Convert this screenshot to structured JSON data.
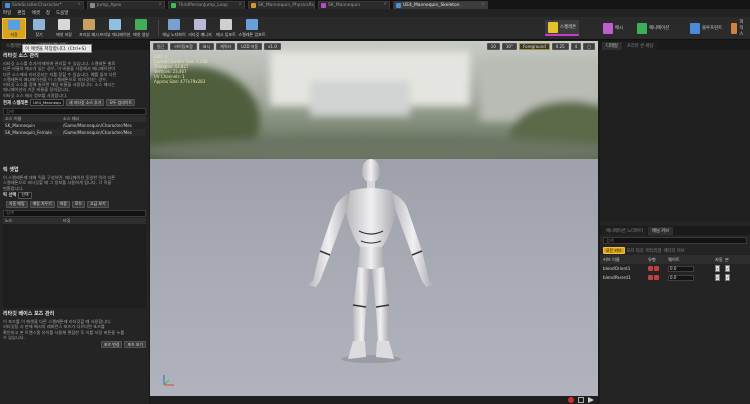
{
  "tabs": [
    {
      "label": "SideScrollerCharacter*",
      "icon_color": "#4a90d9",
      "active": false
    },
    {
      "label": "Jump_Apex",
      "icon_color": "#8a8a8a",
      "active": false
    },
    {
      "label": "ThirdPersonJump_Loop",
      "icon_color": "#3dbd5a",
      "active": false
    },
    {
      "label": "SK_Mannequin_PhysicsAsset",
      "icon_color": "#d29a2a",
      "active": false
    },
    {
      "label": "SK_Mannequin",
      "icon_color": "#b050c8",
      "active": false
    },
    {
      "label": "UE4_Mannequin_Skeleton",
      "icon_color": "#4a90d9",
      "active": true
    }
  ],
  "menu": [
    "파일",
    "편집",
    "애셋",
    "창",
    "도움말"
  ],
  "toolbar": {
    "buttons": [
      {
        "label": "저장",
        "icon_color": "#5aa0e0"
      },
      {
        "label": "찾기",
        "icon_color": "#8fb4d8"
      },
      {
        "label": "애셋 저장",
        "icon_color": "#d8d8d8"
      },
      {
        "label": "프리뷰 메시",
        "icon_color": "#c8a060"
      },
      {
        "label": "프리뷰 애니메이션",
        "icon_color": "#8fc0e0"
      },
      {
        "label": "애셋 생성",
        "icon_color": "#3fae56"
      }
    ],
    "right_buttons": [
      {
        "label": "애님 노티파이",
        "icon_color": "#7aa0d0"
      },
      {
        "label": "리타깃 매니저",
        "icon_color": "#b8b8d8"
      },
      {
        "label": "메시 임포트",
        "icon_color": "#d0d0d0"
      },
      {
        "label": "스켈레톤 임포트",
        "icon_color": "#6aa0d8"
      }
    ],
    "modes": [
      {
        "label": "스켈레톤",
        "icon_color": "#e6c229",
        "active": true
      },
      {
        "label": "메시",
        "icon_color": "#c060d0",
        "active": false
      },
      {
        "label": "애니메이션",
        "icon_color": "#3fae56",
        "active": false
      },
      {
        "label": "블루프린트",
        "icon_color": "#4a8ad8",
        "active": false
      },
      {
        "label": "피직스",
        "icon_color": "#d08040",
        "active": false
      }
    ]
  },
  "tooltip": "이 애셋을 저장합니다. (Ctrl+S)",
  "left_panel": {
    "tabs": [
      "스켈레톤 트리",
      "리타깃 매니저"
    ],
    "retarget_source": {
      "title": "리타깃 소스 관리",
      "desc": [
        "리타깃 소스를 추가/삭제하여 관리할 수 있습니다. 스켈레톤 별로",
        "다른 비율의 메시가 있는 경우, 이 비율을 사용해서 애니메이션이",
        "다른 소스에서 리타깃되는 지를 정할 수 있습니다. 예를 들어 다른",
        "스켈레톤의 애니메이션을 이 스켈레톤으로 리타깃하는 경우,",
        "리타깃 소스를 정해 놓으면 해당 비율을 사용합니다. 소스 메시는",
        "애니메이션의 기준 비율을 정의합니다.",
        "리타깃 소스 메시 정보를 사용합니다."
      ],
      "current_label": "현재 스켈레톤",
      "current_value": "UE4_Mannequ",
      "add_button": "새 리타깃 소스 추가",
      "update_button": "모두 업데이트",
      "search_placeholder": "검색",
      "columns": [
        "소스 이름",
        "소스 메시"
      ],
      "rows": [
        {
          "name": "SK_Mannequin",
          "mesh": "/Game/Mannequin/Character/Mes"
        },
        {
          "name": "SK_Mannequin_Female",
          "mesh": "/Game/Mannequin/Character/Mes"
        }
      ]
    },
    "rig_setup": {
      "title": "릭 셋업",
      "desc": [
        "이 스켈레톤에 대해 릭을 구성하면, 애니메이션 동일한 릭의 다른",
        "스켈레톤으로 리타깃할 때 그 정보를 사용하게 됩니다. 각 릭을",
        "변환합니다."
      ],
      "select_label": "릭 선택",
      "select_value": "선택",
      "buttons": [
        "자동 매핑",
        "매핑 지우기",
        "저장",
        "로드",
        "고급 보기"
      ],
      "search_placeholder": "검색",
      "columns": [
        "노드",
        "타깃"
      ]
    },
    "base_pose": {
      "title": "리타깃 베이스 포즈 관리",
      "desc": [
        "이 포즈를 이 애셋을 다른 스켈레톤에 리타깃할 때 사용합니다.",
        "리타깃팅 시 판에 메시의 레퍼런스 포즈가 다르다면 포즈를",
        "확인하고 본 트랜스폼 유치를 사용해 편집한 후 이를 저장 버튼을 누를",
        "수 있습니다."
      ],
      "buttons": [
        "포즈 변경",
        "포즈 보기"
      ]
    }
  },
  "viewport": {
    "buttons": [
      "원근",
      "라이팅포함",
      "표시",
      "캐릭터",
      "LOD 자동",
      "x1.0"
    ],
    "right_buttons": [
      "10",
      "10°",
      "Foreground",
      "0.25",
      "4"
    ],
    "stats": [
      "LOD: 0",
      "Current Screen Size: 1.048",
      "Triangles: 43,827",
      "Vertices: 23,467",
      "UV Channels: 1",
      "Approx Size: 477x79x283"
    ]
  },
  "right_panel": {
    "upper_tabs": [
      "디테일",
      "프리뷰 씬 세팅"
    ],
    "lower_tabs": [
      "애니메이션 노티파이",
      "애님 커브"
    ],
    "search_placeholder": "검색",
    "filters": [
      {
        "label": "모든 커브",
        "on": true
      },
      {
        "label": "모프 타깃",
        "on": false
      },
      {
        "label": "머티리얼",
        "on": false
      },
      {
        "label": "에디터 커브",
        "on": false
      }
    ],
    "columns": [
      "커브 이름",
      "유형",
      "웨이트",
      "자동",
      "본"
    ],
    "curves": [
      {
        "name": "blendOrient1",
        "weight": "0.0"
      },
      {
        "name": "blendParent1",
        "weight": "0.0"
      }
    ]
  }
}
